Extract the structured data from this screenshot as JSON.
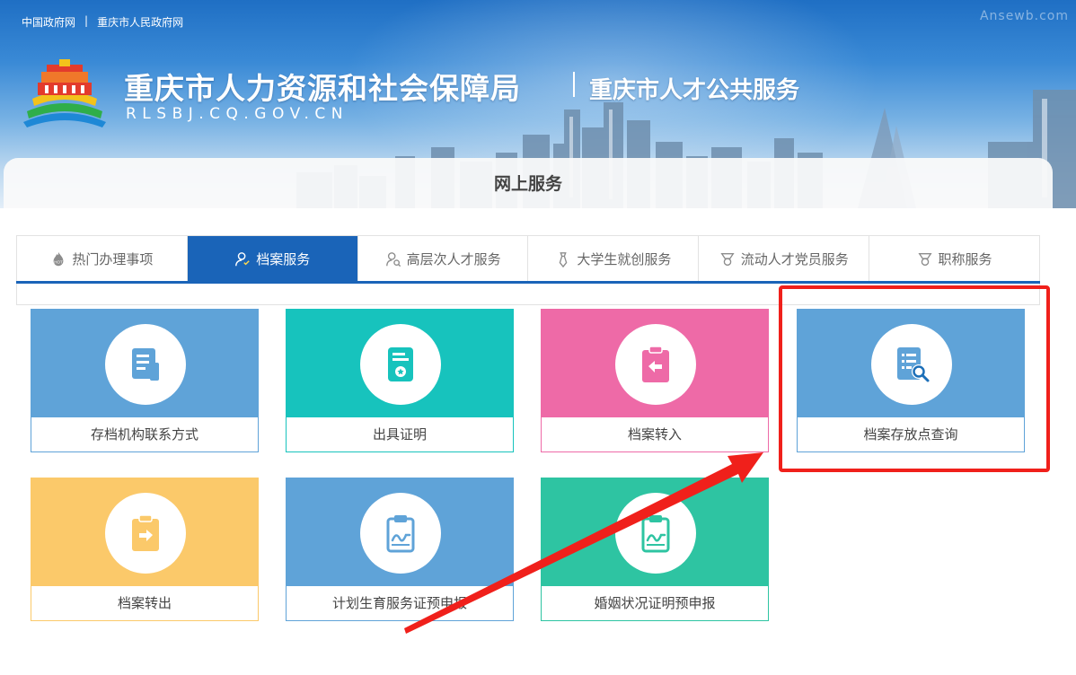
{
  "top_links": {
    "gov_link": "中国政府网",
    "separator": "|",
    "city_link": "重庆市人民政府网"
  },
  "watermark": "Ansewb.com",
  "header": {
    "title": "重庆市人力资源和社会保障局",
    "subtitle": "重庆市人才公共服务",
    "domain": "RLSBJ.CQ.GOV.CN"
  },
  "section_title": "网上服务",
  "tabs": [
    {
      "label": "热门办理事项",
      "icon": "hot-flame-icon"
    },
    {
      "label": "档案服务",
      "icon": "user-archive-icon",
      "active": true
    },
    {
      "label": "高层次人才服务",
      "icon": "user-search-icon"
    },
    {
      "label": "大学生就创服务",
      "icon": "tie-icon"
    },
    {
      "label": "流动人才党员服务",
      "icon": "medal-icon"
    },
    {
      "label": "职称服务",
      "icon": "medal-icon"
    }
  ],
  "services": [
    {
      "label": "存档机构联系方式",
      "icon": "document-list-icon",
      "color": "#5fa3d8"
    },
    {
      "label": "出具证明",
      "icon": "certificate-icon",
      "color": "#17c3bd"
    },
    {
      "label": "档案转入",
      "icon": "clipboard-return-icon",
      "color": "#ee6aa7"
    },
    {
      "label": "档案存放点查询",
      "icon": "document-search-icon",
      "color": "#5fa3d8"
    },
    {
      "label": "档案转出",
      "icon": "clipboard-forward-icon",
      "color": "#fbc96a"
    },
    {
      "label": "计划生育服务证预申报",
      "icon": "clipboard-sign-icon",
      "color": "#5fa3d8"
    },
    {
      "label": "婚姻状况证明预申报",
      "icon": "clipboard-sign-icon",
      "color": "#2ec4a2"
    }
  ],
  "colors": {
    "primary_blue": "#1a64b8",
    "annotation_red": "#f0201b"
  }
}
